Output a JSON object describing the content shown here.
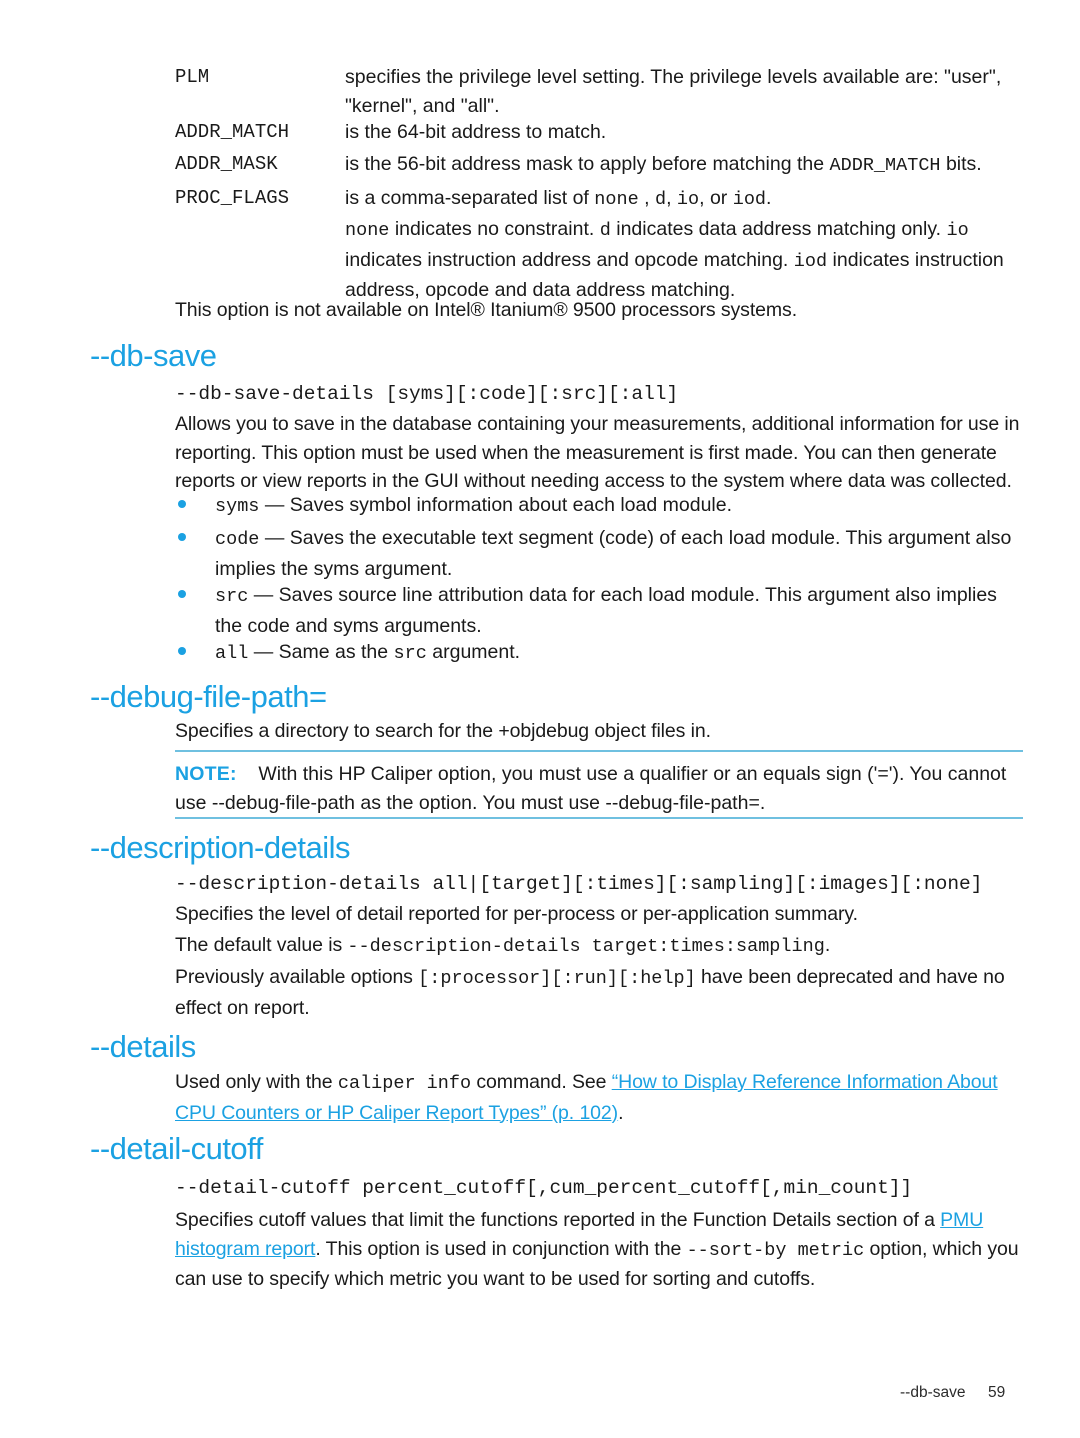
{
  "document": {
    "footer": {
      "section_label": "--db-save",
      "page_number": "59"
    }
  },
  "param_definitions": {
    "items": [
      {
        "term": "PLM",
        "definition": "specifies the privilege level setting. The privilege levels available are: \"user\", \"kernel\", and \"all\"."
      },
      {
        "term": "ADDR_MATCH",
        "definition_pre": "is the 64-bit address to match.",
        "definition": "is the 64-bit address to match."
      },
      {
        "term": "ADDR_MASK",
        "def_part1": "is the 56-bit address mask to apply before matching the ",
        "def_code": "ADDR_MATCH",
        "def_part2": " bits."
      },
      {
        "term": "PROC_FLAGS",
        "def_part1": "is a comma-separated list of ",
        "def_code1": "none",
        "def_part2": " , ",
        "def_code2": "d",
        "def_part3": ", ",
        "def_code3": "io",
        "def_part4": ", or ",
        "def_code4": "iod",
        "def_part5": "."
      }
    ],
    "proc_flags_detail": {
      "code1": "none",
      "text1": " indicates no constraint. ",
      "code2": "d",
      "text2": " indicates data address matching only. ",
      "code3": "io",
      "text3": " indicates instruction address and opcode matching. ",
      "code4": "iod",
      "text4": " indicates instruction address, opcode and data address matching."
    },
    "availability_note": "This option is not available on Intel® Itanium® 9500 processors systems."
  },
  "sections": {
    "db_save": {
      "heading": "--db-save",
      "syntax": "--db-save-details [syms][:code][:src][:all]",
      "description": "Allows you to save in the database containing your measurements, additional information for use in reporting. This option must be used when the measurement is first made. You can then generate reports or view reports in the GUI without needing access to the system where data was collected.",
      "bullets": [
        {
          "code": "syms",
          "text": " — Saves symbol information about each load module."
        },
        {
          "code": "code",
          "text": " — Saves the executable text segment (code) of each load module. This argument also implies the syms argument."
        },
        {
          "code": "src",
          "text": " — Saves source line attribution data for each load module. This argument also implies the code and syms arguments."
        },
        {
          "code": "all",
          "text_pre": " — Same as the ",
          "code2": "src",
          "text_post": " argument."
        }
      ]
    },
    "debug_file_path": {
      "heading": "--debug-file-path=",
      "description": "Specifies a directory to search for the +objdebug object files in.",
      "note": {
        "label": "NOTE:",
        "text": "With this HP Caliper option, you must use a qualifier or an equals sign ('='). You cannot use --debug-file-path as the option. You must use --debug-file-path=."
      }
    },
    "description_details": {
      "heading": "--description-details",
      "syntax": "--description-details all|[target][:times][:sampling][:images][:none]",
      "paragraph1": "Specifies the level of detail reported for per-process or per-application summary.",
      "paragraph2_pre": "The default value is ",
      "paragraph2_code": "--description-details target:times:sampling",
      "paragraph2_post": ".",
      "paragraph3_pre": "Previously available options ",
      "paragraph3_code": "[:processor][:run][:help]",
      "paragraph3_post": " have been deprecated and have no effect on report."
    },
    "details": {
      "heading": "--details",
      "text_pre": "Used only with the ",
      "code": "caliper info",
      "text_mid": " command. See ",
      "link": "“How to Display Reference Information About CPU Counters or HP Caliper Report Types” (p. 102)",
      "text_post": "."
    },
    "detail_cutoff": {
      "heading": "--detail-cutoff",
      "syntax": "--detail-cutoff percent_cutoff[,cum_percent_cutoff[,min_count]]",
      "desc_pre": "Specifies cutoff values that limit the functions reported in the Function Details section of a ",
      "desc_link": "PMU histogram report",
      "desc_mid": ". This option is used in conjunction with the ",
      "desc_code": "--sort-by metric",
      "desc_post": " option, which you can use to specify which metric you want to be used for sorting and cutoffs."
    }
  },
  "colors": {
    "heading_blue": "#1ba1e2",
    "link_blue": "#1ba1e2",
    "rule_blue": "#6fc0e0",
    "body_text": "#1a1a1a"
  }
}
